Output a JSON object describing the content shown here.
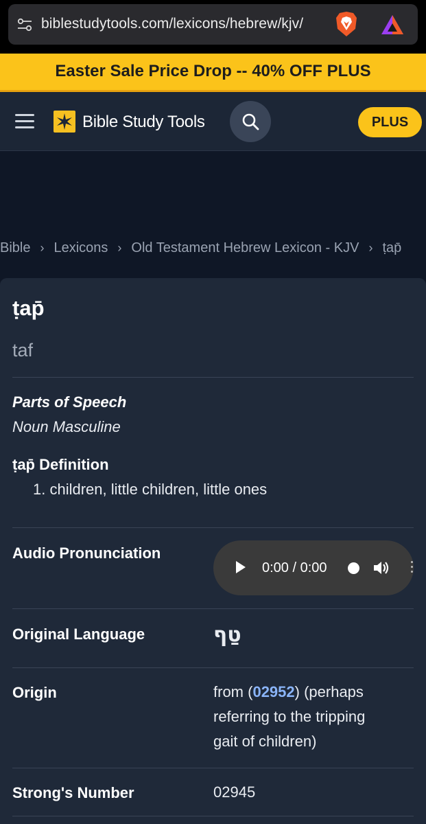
{
  "browser": {
    "url": "biblestudytools.com/lexicons/hebrew/kjv/"
  },
  "banner": {
    "text": "Easter Sale Price Drop -- 40% OFF PLUS"
  },
  "header": {
    "logo_text": "Bible Study Tools",
    "plus_label": "PLUS"
  },
  "breadcrumb": {
    "items": [
      "Bible",
      "Lexicons",
      "Old Testament Hebrew Lexicon - KJV",
      "ṭap̄"
    ]
  },
  "entry": {
    "title": "ṭap̄",
    "transliteration": "taf",
    "parts_of_speech_label": "Parts of Speech",
    "parts_of_speech_value": "Noun Masculine",
    "definition_label": "ṭap̄ Definition",
    "definitions": [
      "1. children, little children, little ones"
    ],
    "audio_label": "Audio Pronunciation",
    "audio_time": "0:00 / 0:00",
    "original_language_label": "Original Language",
    "original_language_value": "טַף",
    "origin_label": "Origin",
    "origin_prefix": "from (",
    "origin_link": "02952",
    "origin_suffix_1": ") (perhaps",
    "origin_line_2": "referring to the tripping",
    "origin_line_3": "gait of children)",
    "strongs_label": "Strong's Number",
    "strongs_value": "02945"
  },
  "colors": {
    "accent": "#fbc31a",
    "link": "#8ab4f8",
    "card_bg": "#1f2939"
  }
}
